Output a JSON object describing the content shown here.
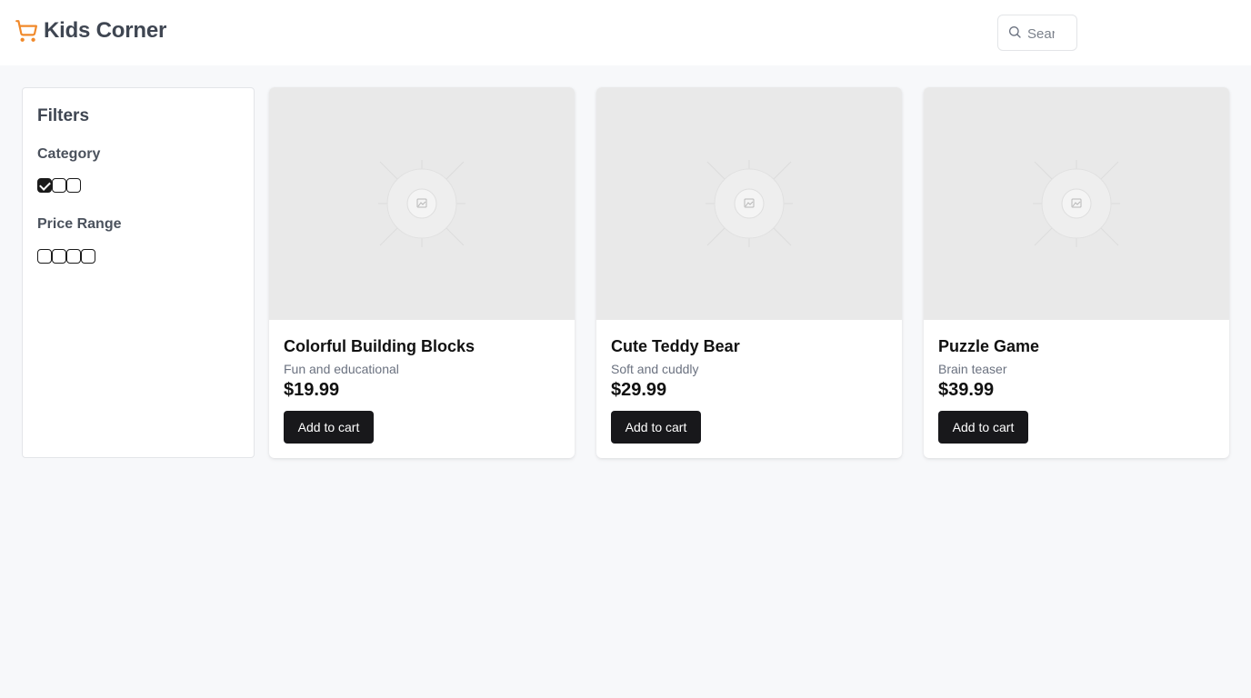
{
  "header": {
    "brand_title": "Kids Corner",
    "search_placeholder": "Search"
  },
  "colors": {
    "brand_accent": "#f0892a",
    "button_bg": "#18181b",
    "page_bg": "#f7f8fa"
  },
  "filters": {
    "title": "Filters",
    "category": {
      "label": "Category",
      "checkboxes": [
        true,
        false,
        false
      ]
    },
    "price_range": {
      "label": "Price Range",
      "checkboxes": [
        false,
        false,
        false,
        false
      ]
    }
  },
  "products": [
    {
      "name": "Colorful Building Blocks",
      "description": "Fun and educational",
      "price": "$19.99",
      "button_label": "Add to cart",
      "image_icon": "image-placeholder-icon"
    },
    {
      "name": "Cute Teddy Bear",
      "description": "Soft and cuddly",
      "price": "$29.99",
      "button_label": "Add to cart",
      "image_icon": "image-placeholder-icon"
    },
    {
      "name": "Puzzle Game",
      "description": "Brain teaser",
      "price": "$39.99",
      "button_label": "Add to cart",
      "image_icon": "image-placeholder-icon"
    }
  ]
}
